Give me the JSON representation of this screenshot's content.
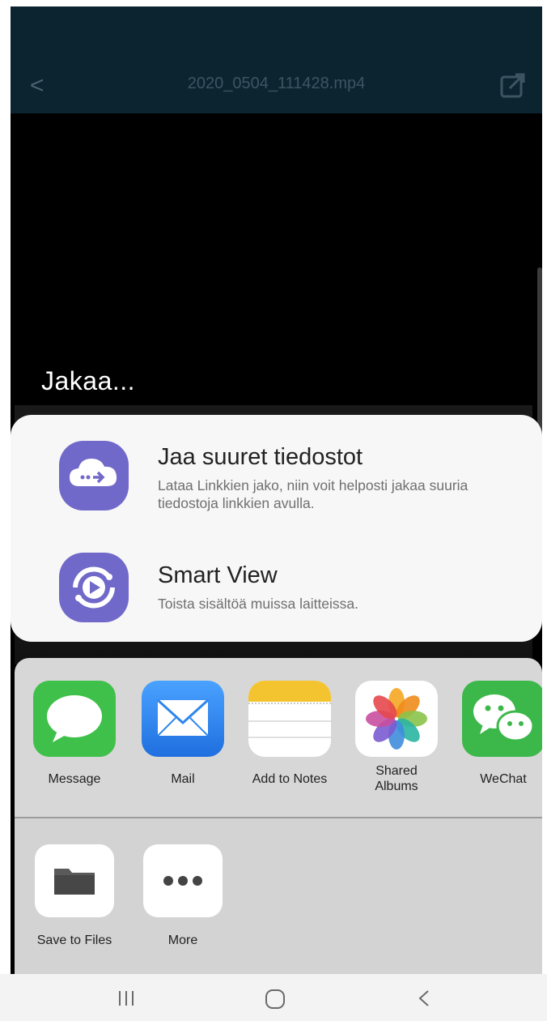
{
  "header": {
    "back_symbol": "<",
    "file_name": "2020_0504_111428.mp4",
    "share_icon": "share-icon"
  },
  "share_title": "Jakaa...",
  "samsung_options": [
    {
      "title": "Jaa suuret tiedostot",
      "description": "Lataa Linkkien jako, niin voit helposti jakaa suuria tiedostoja linkkien avulla.",
      "icon": "cloud-link-icon",
      "color": "#7169c9"
    },
    {
      "title": "Smart View",
      "description": "Toista sisältöä muissa laitteissa.",
      "icon": "smart-view-icon",
      "color": "#7169c9"
    }
  ],
  "ios_apps": [
    {
      "label": "Message",
      "icon": "message-icon",
      "color": "#3fc04a"
    },
    {
      "label": "Mail",
      "icon": "mail-icon",
      "color": "#2e86ee"
    },
    {
      "label": "Add to Notes",
      "icon": "notes-icon",
      "color": "#f4c430"
    },
    {
      "label": "Shared Albums",
      "icon": "photos-icon",
      "color": "#ffffff"
    },
    {
      "label": "WeChat",
      "icon": "wechat-icon",
      "color": "#3cb84a"
    }
  ],
  "ios_actions": [
    {
      "label": "Save to Files",
      "icon": "folder-icon"
    },
    {
      "label": "More",
      "icon": "more-dots-icon"
    }
  ],
  "nav": {
    "recents_icon": "recents-icon",
    "home_icon": "home-icon",
    "back_icon": "back-icon"
  }
}
